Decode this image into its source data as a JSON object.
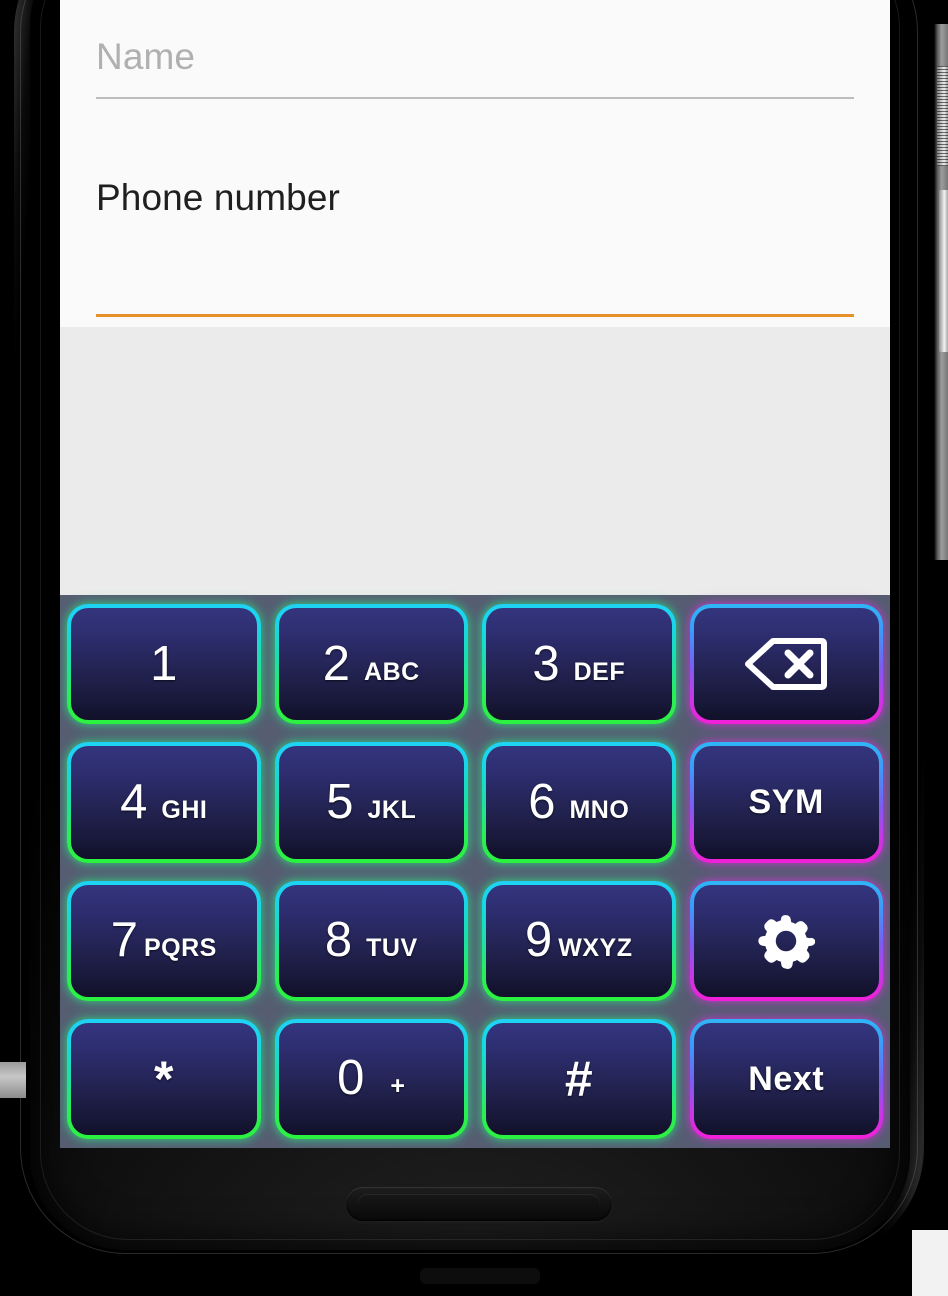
{
  "device": {
    "type": "android-phone",
    "bezel_color": "#000000",
    "home_pill": "speaker-grille"
  },
  "screen": {
    "background": "#ebebeb",
    "form": {
      "background": "#fafafa",
      "fields": [
        {
          "name": "name-field",
          "label": "Name",
          "value": "",
          "placeholder": "Name",
          "state": "inactive",
          "label_color": "#b0b0b0",
          "underline_color": "#bdbdbd"
        },
        {
          "name": "phone-number-field",
          "label": "Phone number",
          "value": "",
          "placeholder": "Phone number",
          "state": "focused",
          "label_color": "#1f1f1f",
          "underline_color": "#e8902a"
        }
      ]
    }
  },
  "keyboard": {
    "type": "phone-numeric-keypad",
    "background": "#575d71",
    "key_fill_top": "#35357e",
    "key_fill_bottom": "#11112a",
    "digit_border_gradient": [
      "#1fd3f5",
      "#2bf23f"
    ],
    "function_border_gradient": [
      "#2fb6f7",
      "#f220d8"
    ],
    "rows": [
      [
        {
          "name": "key-1",
          "digit": "1",
          "sub": "",
          "kind": "digit",
          "accent": "green"
        },
        {
          "name": "key-2",
          "digit": "2",
          "sub": "ABC",
          "kind": "digit",
          "accent": "green"
        },
        {
          "name": "key-3",
          "digit": "3",
          "sub": "DEF",
          "kind": "digit",
          "accent": "green"
        },
        {
          "name": "key-backspace",
          "digit": "",
          "sub": "",
          "kind": "icon",
          "icon": "backspace-icon",
          "accent": "magenta"
        }
      ],
      [
        {
          "name": "key-4",
          "digit": "4",
          "sub": "GHI",
          "kind": "digit",
          "accent": "green"
        },
        {
          "name": "key-5",
          "digit": "5",
          "sub": "JKL",
          "kind": "digit",
          "accent": "green"
        },
        {
          "name": "key-6",
          "digit": "6",
          "sub": "MNO",
          "kind": "digit",
          "accent": "green"
        },
        {
          "name": "key-symbols",
          "digit": "",
          "sub": "",
          "kind": "word",
          "label": "SYM",
          "accent": "magenta"
        }
      ],
      [
        {
          "name": "key-7",
          "digit": "7",
          "sub": "PQRS",
          "kind": "digit",
          "accent": "green"
        },
        {
          "name": "key-8",
          "digit": "8",
          "sub": "TUV",
          "kind": "digit",
          "accent": "green"
        },
        {
          "name": "key-9",
          "digit": "9",
          "sub": "WXYZ",
          "kind": "digit",
          "accent": "green"
        },
        {
          "name": "key-settings",
          "digit": "",
          "sub": "",
          "kind": "icon",
          "icon": "gear-icon",
          "accent": "magenta"
        }
      ],
      [
        {
          "name": "key-asterisk",
          "digit": "*",
          "sub": "",
          "kind": "glyph",
          "accent": "green"
        },
        {
          "name": "key-0",
          "digit": "0",
          "sub": "+",
          "kind": "digit",
          "accent": "green"
        },
        {
          "name": "key-hash",
          "digit": "#",
          "sub": "",
          "kind": "glyph",
          "accent": "green"
        },
        {
          "name": "key-next",
          "digit": "",
          "sub": "",
          "kind": "word",
          "label": "Next",
          "accent": "magenta"
        }
      ]
    ]
  }
}
